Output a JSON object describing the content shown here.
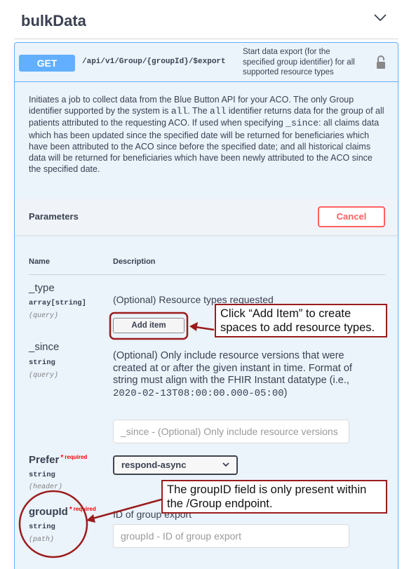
{
  "section": {
    "title": "bulkData"
  },
  "operation": {
    "method": "GET",
    "path": "/api/v1/Group/{groupId}/$export",
    "summary": "Start data export (for the specified group identifier) for all supported resource types",
    "description_parts": [
      "Initiates a job to collect data from the Blue Button API for your ACO. The only Group identifier supported by the system is ",
      "all",
      ". The ",
      "all",
      " identifier returns data for the group of all patients attributed to the requesting ACO. If used when specifying ",
      "_since",
      ": all claims data which has been updated since the specified date will be returned for beneficiaries which have been attributed to the ACO since before the specified date; and all historical claims data will be returned for beneficiaries which have been newly attributed to the ACO since the specified date."
    ]
  },
  "parameters": {
    "title": "Parameters",
    "cancel_label": "Cancel",
    "col_name": "Name",
    "col_description": "Description",
    "required_label": "required",
    "items": [
      {
        "name": "_type",
        "type": "array[string]",
        "in": "(query)",
        "description": "(Optional) Resource types requested",
        "button": "Add item"
      },
      {
        "name": "_since",
        "type": "string",
        "in": "(query)",
        "description_before": "(Optional) Only include resource versions that were created at or after the given instant in time. Format of string must align with the FHIR Instant datatype (i.e., ",
        "description_code": "2020-02-13T08:00:00.000-05:00",
        "description_after": ")",
        "placeholder": "_since - (Optional) Only include resource versions"
      },
      {
        "name": "Prefer",
        "type": "string",
        "in": "(header)",
        "selected": "respond-async"
      },
      {
        "name": "groupId",
        "type": "string",
        "in": "(path)",
        "description": "ID of group export",
        "placeholder": "groupId - ID of group export"
      }
    ]
  },
  "annotations": {
    "callout1": "Click “Add Item” to create spaces to add resource types.",
    "callout2": "The groupID field is only present within the /Group endpoint."
  },
  "colors": {
    "get": "#61affe",
    "cancel": "#ff6060",
    "annotation": "#9b1c1c"
  }
}
